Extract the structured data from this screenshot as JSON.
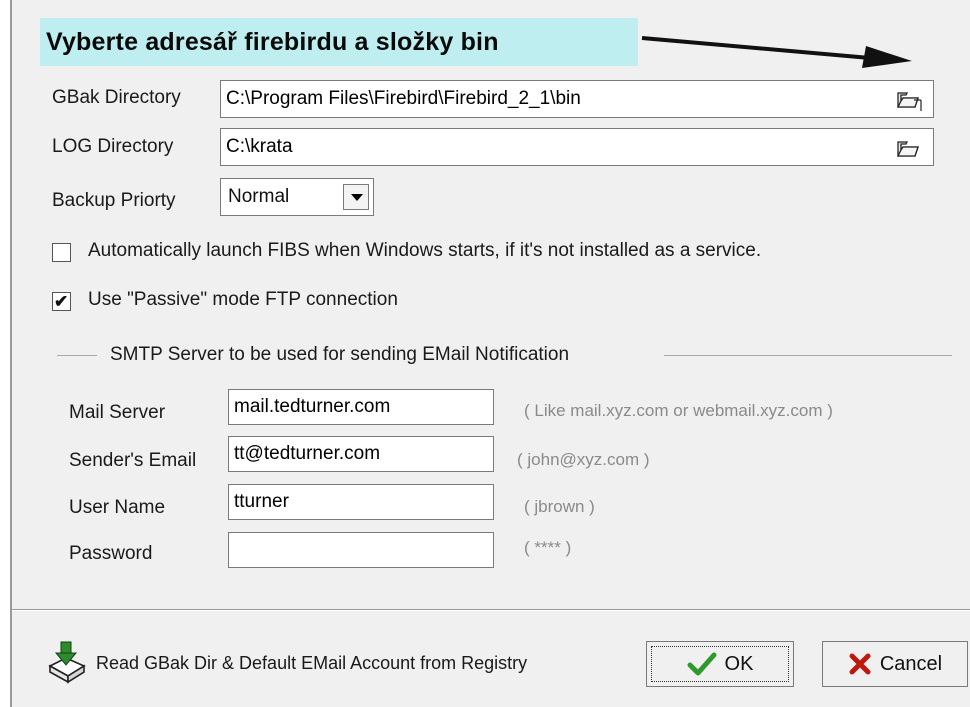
{
  "banner": {
    "title": "Vyberte adresář firebirdu a složky bin"
  },
  "gbak": {
    "label": "GBak Directory",
    "value": "C:\\Program Files\\Firebird\\Firebird_2_1\\bin"
  },
  "log": {
    "label": "LOG Directory",
    "value": "C:\\krata"
  },
  "priority": {
    "label": "Backup Priorty",
    "selected": "Normal"
  },
  "options": {
    "autolaunch": {
      "label": "Automatically launch FIBS  when Windows starts,  if it's not installed as a service.",
      "checked": false
    },
    "passive": {
      "label": "Use \"Passive\" mode FTP connection",
      "checked": true
    }
  },
  "smtp": {
    "group_title": "SMTP Server to be used for sending EMail Notification",
    "mail_server": {
      "label": "Mail Server",
      "value": "mail.tedturner.com",
      "hint": "( Like  mail.xyz.com  or webmail.xyz.com )"
    },
    "sender_email": {
      "label": "Sender's Email",
      "value": "tt@tedturner.com",
      "hint": "( john@xyz.com )"
    },
    "user_name": {
      "label": "User Name",
      "value": "tturner",
      "hint": "( jbrown )"
    },
    "password": {
      "label": "Password",
      "value": "",
      "hint": "( **** )"
    }
  },
  "footer": {
    "registry_label": "Read GBak Dir & Default EMail Account from Registry",
    "ok_label": "OK",
    "cancel_label": "Cancel"
  },
  "colors": {
    "banner_bg": "#bfeef0",
    "ok_check": "#2e9a2e",
    "cancel_x": "#c0180c"
  }
}
